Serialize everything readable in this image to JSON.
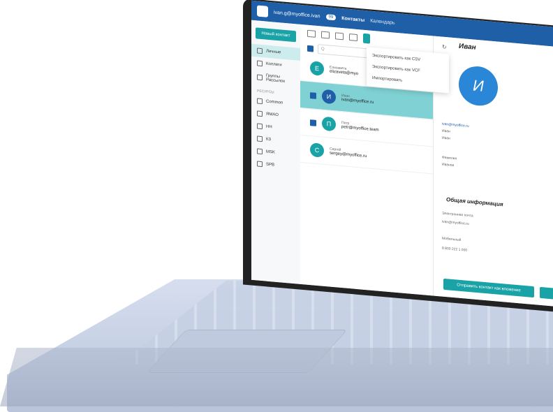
{
  "topbar": {
    "account": "ivan.g@myoffice.ivan",
    "account_badge": "99",
    "tabs": [
      {
        "label": "Контакты"
      },
      {
        "label": "Календарь"
      }
    ]
  },
  "sidebar": {
    "new_contact": "Новый контакт",
    "items": [
      {
        "label": "Личные"
      },
      {
        "label": "Коллеги"
      },
      {
        "label": "Группы Рассылок"
      }
    ],
    "resources_title": "РЕСУРСЫ",
    "resources": [
      {
        "label": "Common"
      },
      {
        "label": "ЯМАО"
      },
      {
        "label": "НН"
      },
      {
        "label": "КЗ"
      },
      {
        "label": "MSK"
      },
      {
        "label": "SPB"
      }
    ]
  },
  "list": {
    "search_placeholder": "Q",
    "contacts": [
      {
        "initial": "Е",
        "name": "Елизавета",
        "email": "elizaveta@myo"
      },
      {
        "initial": "И",
        "name": "Иван",
        "email": "ivan@myoffice.ru"
      },
      {
        "initial": "П",
        "name": "Петр",
        "email": "petr@myoffice.team"
      },
      {
        "initial": "С",
        "name": "Сергей",
        "email": "sergey@myoffice.ru"
      }
    ]
  },
  "menu": {
    "items": [
      {
        "label": "Экспортировать как CSV"
      },
      {
        "label": "Экспортировать как VCF"
      },
      {
        "label": "Импортировать"
      }
    ]
  },
  "detail": {
    "title": "Иван",
    "avatar_initial": "И",
    "email": "ivan@myoffice.ru",
    "first_name": "Иван",
    "last_name_value": "Иван",
    "surname_label": "Фамилия",
    "surname_value": "Иванов",
    "section_title": "Общая информация",
    "email_label": "Электронная почта",
    "email_value": "ivan@myoffice.ru",
    "phone_label": "Мобильный",
    "phone_value": "8 800 222 1 000",
    "send_label": "Отправить контакт как вложение"
  }
}
